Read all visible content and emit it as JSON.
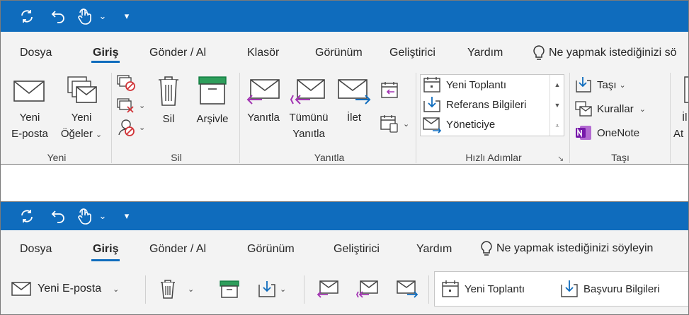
{
  "qat": {
    "chevron": "⌄",
    "customize": "▾",
    "icons": [
      "sync-icon",
      "undo-icon",
      "touch-mode-icon"
    ]
  },
  "tabs": [
    "Dosya",
    "Giriş",
    "Gönder / Al",
    "Klasör",
    "Görünüm",
    "Geliştirici",
    "Yardım"
  ],
  "tabs_simplified": [
    "Dosya",
    "Giriş",
    "Gönder / Al",
    "Görünüm",
    "Geliştirici",
    "Yardım"
  ],
  "active_tab": "Giriş",
  "tell_me": "Ne yapmak istediğinizi sö",
  "tell_me_full": "Ne yapmak istediğinizi söyleyin",
  "groups": {
    "new": {
      "label": "Yeni",
      "new_email": [
        "Yeni",
        "E-posta"
      ],
      "new_items": [
        "Yeni",
        "Öğeler"
      ]
    },
    "delete": {
      "label": "Sil",
      "delete": "Sil",
      "archive": "Arşivle"
    },
    "respond": {
      "label": "Yanıtla",
      "reply": "Yanıtla",
      "reply_all": [
        "Tümünü",
        "Yanıtla"
      ],
      "forward": "İlet"
    },
    "quick_steps": {
      "label": "Hızlı Adımlar",
      "items": [
        "Yeni Toplantı",
        "Referans Bilgileri",
        "Yöneticiye"
      ]
    },
    "move": {
      "label": "Taşı",
      "move": "Taşı",
      "rules": "Kurallar",
      "onenote": "OneNote"
    },
    "partial": {
      "line1": "İl",
      "line2": "At"
    }
  },
  "simplified": {
    "new_email": "Yeni E-posta",
    "quick_steps": [
      "Yeni Toplantı",
      "Başvuru Bilgileri"
    ]
  },
  "colors": {
    "brand": "#0f6cbd",
    "reply_purple": "#a335b3",
    "forward_blue": "#0f6cbd",
    "delete_red": "#d13438",
    "archive_green": "#107c41",
    "onenote": "#7719aa"
  }
}
